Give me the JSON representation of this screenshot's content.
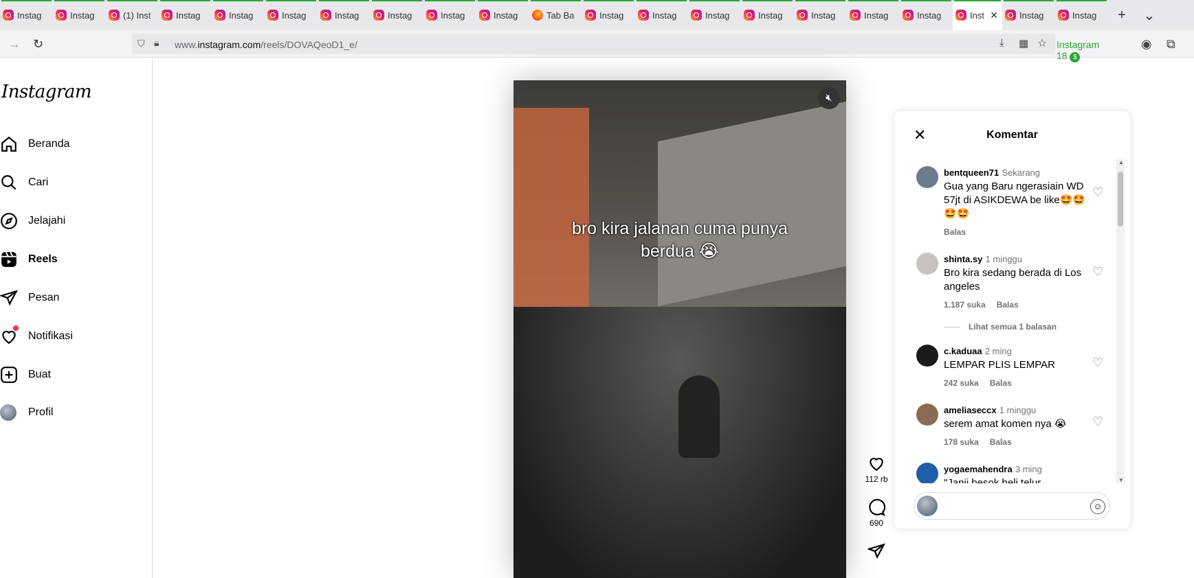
{
  "tabs": [
    {
      "label": "Instag",
      "type": "ig"
    },
    {
      "label": "Instag",
      "type": "ig"
    },
    {
      "label": "(1) Inst",
      "type": "ig"
    },
    {
      "label": "Instag",
      "type": "ig"
    },
    {
      "label": "Instag",
      "type": "ig"
    },
    {
      "label": "Instag",
      "type": "ig"
    },
    {
      "label": "Instag",
      "type": "ig"
    },
    {
      "label": "Instag",
      "type": "ig"
    },
    {
      "label": "Instag",
      "type": "ig"
    },
    {
      "label": "Instag",
      "type": "ig"
    },
    {
      "label": "Tab Ba",
      "type": "ff"
    },
    {
      "label": "Instag",
      "type": "ig"
    },
    {
      "label": "Instag",
      "type": "ig"
    },
    {
      "label": "Instag",
      "type": "ig"
    },
    {
      "label": "Instag",
      "type": "ig"
    },
    {
      "label": "Instag",
      "type": "ig"
    },
    {
      "label": "Instag",
      "type": "ig"
    },
    {
      "label": "Instag",
      "type": "ig"
    },
    {
      "label": "Inst",
      "type": "ig",
      "active": true
    },
    {
      "label": "Instag",
      "type": "ig"
    },
    {
      "label": "Instag",
      "type": "ig"
    }
  ],
  "browser": {
    "url_prefix": "www.",
    "url_domain": "instagram.com",
    "url_path": "/reels/DOVAQeoD1_e/",
    "ext_label": "Instagram 18",
    "ext_badge": "$",
    "new_tab": "+",
    "tab_list": "⌄"
  },
  "sidebar": {
    "logo": "Instagram",
    "items": [
      {
        "label": "Beranda",
        "icon": "home-icon"
      },
      {
        "label": "Cari",
        "icon": "search-icon"
      },
      {
        "label": "Jelajahi",
        "icon": "compass-icon"
      },
      {
        "label": "Reels",
        "icon": "reels-icon",
        "active": true
      },
      {
        "label": "Pesan",
        "icon": "send-icon"
      },
      {
        "label": "Notifikasi",
        "icon": "heart-icon"
      },
      {
        "label": "Buat",
        "icon": "plus-square-icon"
      },
      {
        "label": "Profil",
        "icon": "avatar"
      }
    ]
  },
  "video": {
    "caption_line1": "bro kira jalanan cuma punya",
    "caption_line2": "berdua 😭"
  },
  "actions": {
    "likes": "112 rb",
    "comments": "690"
  },
  "comments_panel": {
    "title": "Komentar",
    "comments": [
      {
        "user": "bentqueen71",
        "time": "Sekarang",
        "text": "Gua yang Baru ngerasiain WD 57jt di ASIKDEWA be like🤩🤩🤩🤩",
        "likes": "",
        "reply": "Balas",
        "avatar_color": "#6b7a8c"
      },
      {
        "user": "shinta.sy",
        "time": "1 minggu",
        "text": "Bro kira sedang berada di Los angeles",
        "likes": "1.187 suka",
        "reply": "Balas",
        "view_replies": "Lihat semua 1 balasan",
        "avatar_color": "#c9c3bd"
      },
      {
        "user": "c.kaduaa",
        "time": "2 ming",
        "text": "LEMPAR PLIS LEMPAR",
        "likes": "242 suka",
        "reply": "Balas",
        "avatar_color": "#1a1a1a"
      },
      {
        "user": "ameliaseccx",
        "time": "1 minggu",
        "text": "serem amat komen nya 😭",
        "likes": "178 suka",
        "reply": "Balas",
        "avatar_color": "#8a6b55"
      },
      {
        "user": "yogaemahendra",
        "time": "3 ming",
        "text": "\"Janji besok beli telur",
        "likes": "",
        "reply": "",
        "avatar_color": "#1f5fa8"
      }
    ]
  }
}
